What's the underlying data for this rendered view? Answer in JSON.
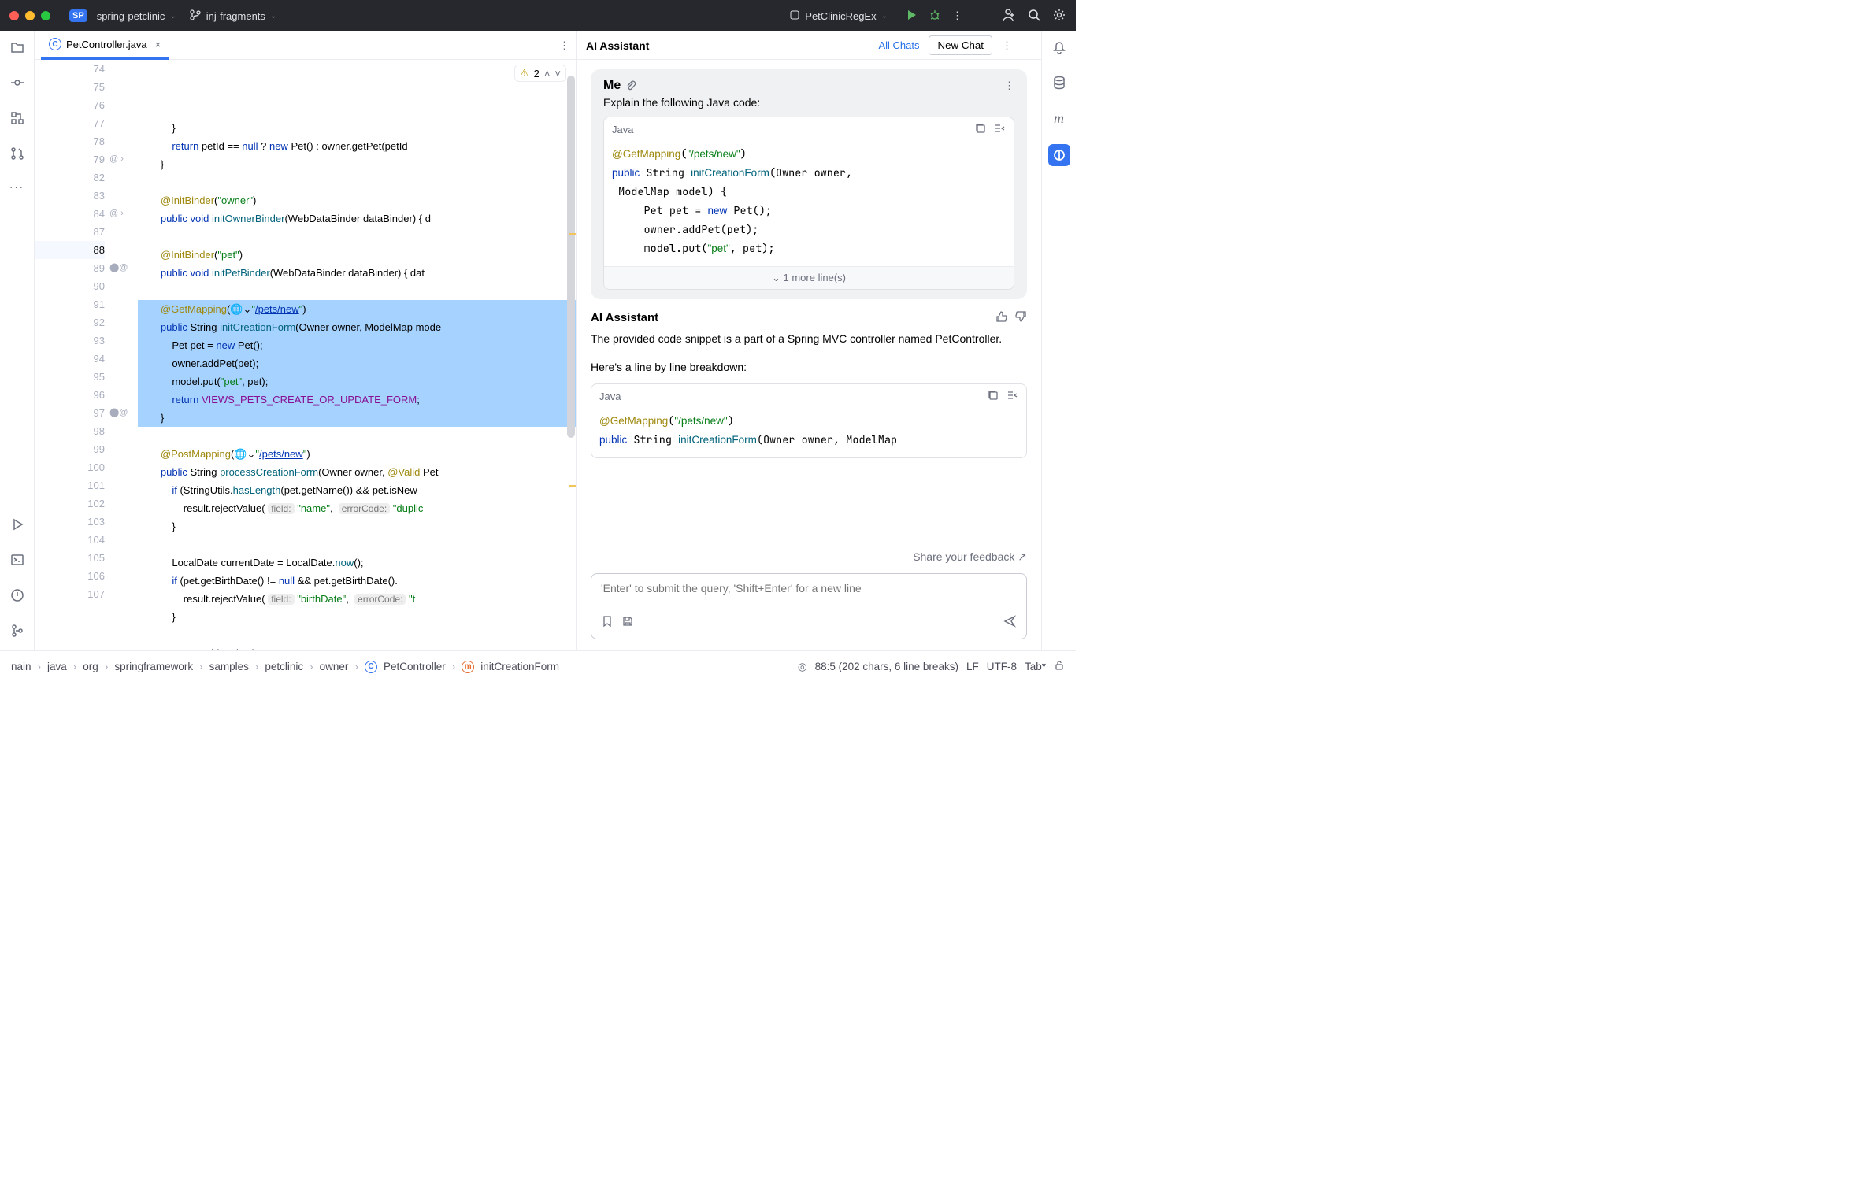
{
  "titlebar": {
    "project_badge": "SP",
    "project_name": "spring-petclinic",
    "branch": "inj-fragments",
    "run_config": "PetClinicRegEx"
  },
  "tabs": {
    "active": "PetController.java"
  },
  "warnings": {
    "count": "2"
  },
  "editor": {
    "lines": [
      {
        "n": "74",
        "code": "            }"
      },
      {
        "n": "75",
        "code": "            <span class='kw'>return</span> petId == <span class='kw'>null</span> ? <span class='kw'>new</span> Pet() : owner.getPet(petId"
      },
      {
        "n": "76",
        "code": "        }"
      },
      {
        "n": "77",
        "code": ""
      },
      {
        "n": "78",
        "code": "        <span class='ann'>@InitBinder</span>(<span class='str'>\"owner\"</span>)"
      },
      {
        "n": "79",
        "code": "        <span class='kw'>public void</span> <span class='mtd'>initOwnerBinder</span>(WebDataBinder dataBinder) { d",
        "mark": "@ ›"
      },
      {
        "n": "82",
        "code": ""
      },
      {
        "n": "83",
        "code": "        <span class='ann'>@InitBinder</span>(<span class='str'>\"pet\"</span>)"
      },
      {
        "n": "84",
        "code": "        <span class='kw'>public void</span> <span class='mtd'>initPetBinder</span>(WebDataBinder dataBinder) { dat",
        "mark": "@ ›"
      },
      {
        "n": "87",
        "code": ""
      },
      {
        "n": "88",
        "code": "        <span class='ann'>@GetMapping</span>(🌐⌄<span class='str'>\"</span><span class='url'>/pets/new</span><span class='str'>\"</span>)",
        "sel": true,
        "cur": true
      },
      {
        "n": "89",
        "code": "        <span class='kw'>public</span> String <span class='mtd'>initCreationForm</span>(Owner owner, ModelMap mode",
        "sel": true,
        "mark": "⬤@"
      },
      {
        "n": "90",
        "code": "            Pet pet = <span class='kw'>new</span> Pet();",
        "sel": true
      },
      {
        "n": "91",
        "code": "            owner.addPet(pet);",
        "sel": true
      },
      {
        "n": "92",
        "code": "            model.put(<span class='str'>\"pet\"</span>, pet);",
        "sel": true
      },
      {
        "n": "93",
        "code": "            <span class='kw'>return</span> <span class='fld'>VIEWS_PETS_CREATE_OR_UPDATE_FORM</span>;",
        "sel": true
      },
      {
        "n": "94",
        "code": "        }",
        "sel": true
      },
      {
        "n": "95",
        "code": ""
      },
      {
        "n": "96",
        "code": "        <span class='ann'>@PostMapping</span>(🌐⌄<span class='str'>\"</span><span class='url'>/pets/new</span><span class='str'>\"</span>)"
      },
      {
        "n": "97",
        "code": "        <span class='kw'>public</span> String <span class='mtd'>processCreationForm</span>(Owner owner, <span class='ann'>@Valid</span> Pet",
        "mark": "⬤@"
      },
      {
        "n": "98",
        "code": "            <span class='kw'>if</span> (StringUtils.<span class='mtd'>hasLength</span>(pet.getName()) && pet.isNew"
      },
      {
        "n": "99",
        "code": "                result.rejectValue( <span class='hint'>field:</span> <span class='str'>\"name\"</span>,  <span class='hint'>errorCode:</span> <span class='str'>\"duplic</span>"
      },
      {
        "n": "100",
        "code": "            }"
      },
      {
        "n": "101",
        "code": ""
      },
      {
        "n": "102",
        "code": "            LocalDate currentDate = LocalDate.<span class='mtd'>now</span>();"
      },
      {
        "n": "103",
        "code": "            <span class='kw'>if</span> (pet.getBirthDate() != <span class='kw'>null</span> && pet.getBirthDate()."
      },
      {
        "n": "104",
        "code": "                result.rejectValue( <span class='hint'>field:</span> <span class='str'>\"birthDate\"</span>,  <span class='hint'>errorCode:</span> <span class='str'>\"t</span>"
      },
      {
        "n": "105",
        "code": "            }"
      },
      {
        "n": "106",
        "code": ""
      },
      {
        "n": "107",
        "code": "            owner.addPet(pet);"
      }
    ]
  },
  "assistant": {
    "title": "AI Assistant",
    "all_chats": "All Chats",
    "new_chat": "New Chat",
    "me_label": "Me",
    "me_text": "Explain the following Java code:",
    "code_lang": "Java",
    "me_code": "<span class='ann'>@GetMapping</span>(<span class='str'>\"/pets/new\"</span>)\n<span class='kw'>public</span> String <span class='mtd'>initCreationForm</span>(Owner owner,\n ModelMap model) {\n     Pet pet = <span class='kw'>new</span> Pet();\n     owner.addPet(pet);\n     model.put(<span class='str'>\"pet\"</span>, pet);",
    "more_lines": "1 more line(s)",
    "ans_label": "AI Assistant",
    "ans_p1": "The provided code snippet is a part of a Spring MVC controller named PetController.",
    "ans_p2": "Here's a line by line breakdown:",
    "ans_code": "<span class='ann'>@GetMapping</span>(<span class='str'>\"/pets/new\"</span>)\n<span class='kw'>public</span> String <span class='mtd'>initCreationForm</span>(Owner owner, ModelMap",
    "feedback": "Share your feedback ↗",
    "placeholder": "'Enter' to submit the query, 'Shift+Enter' for a new line"
  },
  "breadcrumbs": [
    "nain",
    "java",
    "org",
    "springframework",
    "samples",
    "petclinic",
    "owner",
    "PetController",
    "initCreationForm"
  ],
  "status": {
    "pos": "88:5 (202 chars, 6 line breaks)",
    "le": "LF",
    "enc": "UTF-8",
    "indent": "Tab*"
  }
}
